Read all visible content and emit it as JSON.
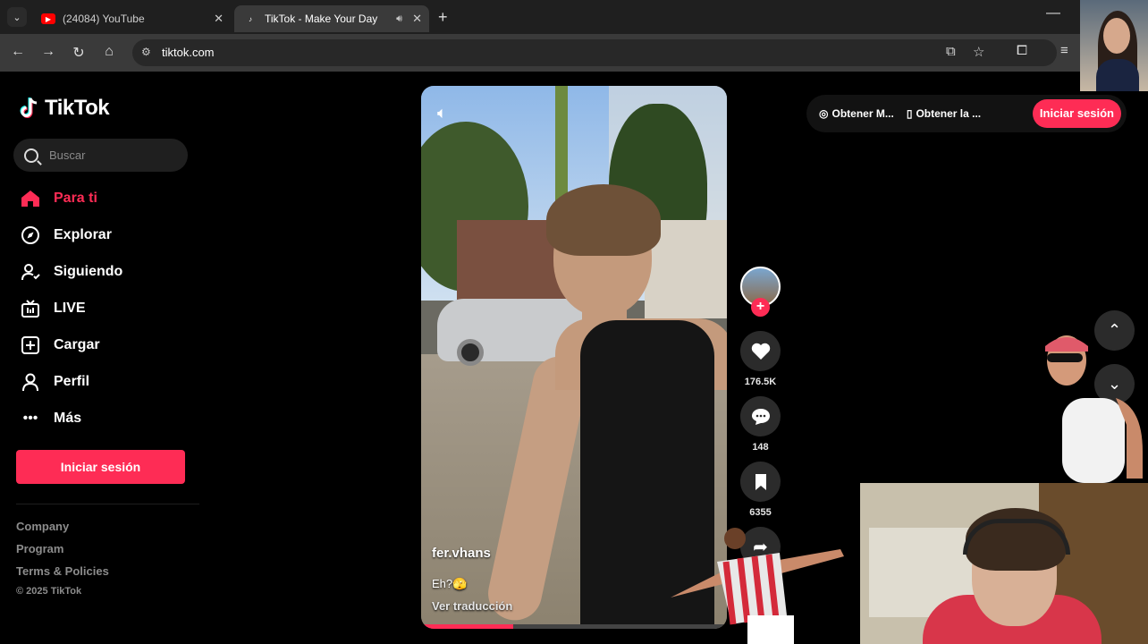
{
  "browser": {
    "tabs": [
      {
        "title": "(24084) YouTube",
        "active": false
      },
      {
        "title": "TikTok - Make Your Day",
        "active": true
      }
    ],
    "url": "tiktok.com"
  },
  "tiktok": {
    "logo": "TikTok",
    "search_placeholder": "Buscar",
    "nav": [
      {
        "label": "Para ti",
        "icon": "home-icon",
        "active": true
      },
      {
        "label": "Explorar",
        "icon": "compass-icon",
        "active": false
      },
      {
        "label": "Siguiendo",
        "icon": "following-icon",
        "active": false
      },
      {
        "label": "LIVE",
        "icon": "live-icon",
        "active": false
      },
      {
        "label": "Cargar",
        "icon": "upload-icon",
        "active": false
      },
      {
        "label": "Perfil",
        "icon": "profile-icon",
        "active": false
      },
      {
        "label": "Más",
        "icon": "more-icon",
        "active": false
      }
    ],
    "login_label": "Iniciar sesión",
    "footer": {
      "company": "Company",
      "program": "Program",
      "terms": "Terms & Policies",
      "copyright": "© 2025 TikTok"
    },
    "topbar": {
      "get_coins": "Obtener M...",
      "get_app": "Obtener la ...",
      "login": "Iniciar sesión"
    },
    "video": {
      "username": "fer.vhans",
      "caption": "Eh?🫣",
      "translate": "Ver traducción",
      "progress": 0.3,
      "likes": "176.5K",
      "comments": "148",
      "saves": "6355"
    }
  },
  "colors": {
    "accent": "#fe2c55",
    "background": "#000000",
    "chrome_dark": "#1f1f1f",
    "chrome_toolbar": "#3a3a3a"
  }
}
